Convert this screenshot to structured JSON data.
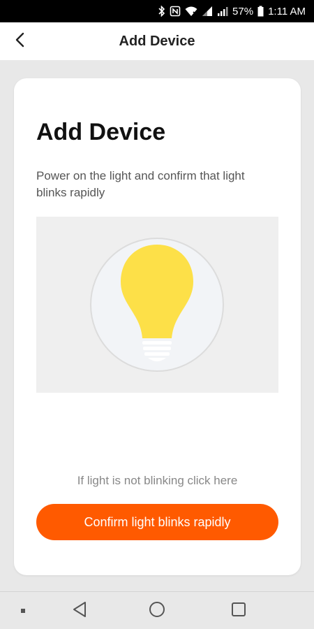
{
  "status_bar": {
    "battery_percent": "57%",
    "time": "1:11 AM",
    "icons": [
      "bluetooth-icon",
      "nfc-icon",
      "wifi-icon",
      "signal-icon",
      "battery-icon"
    ]
  },
  "app_bar": {
    "title": "Add Device",
    "back_icon": "chevron-left-icon"
  },
  "card": {
    "title": "Add Device",
    "description": "Power on the light and confirm that light blinks  rapidly",
    "illustration_icon": "light-bulb-icon",
    "help_link": "If light is not blinking click here",
    "confirm_button": "Confirm light blinks rapidly"
  },
  "colors": {
    "accent": "#ff5a00",
    "bulb": "#fde048",
    "background": "#e8e8e8"
  },
  "nav_bar": {
    "items": [
      "menu-dot-icon",
      "back-triangle-icon",
      "home-circle-icon",
      "recents-square-icon"
    ]
  }
}
